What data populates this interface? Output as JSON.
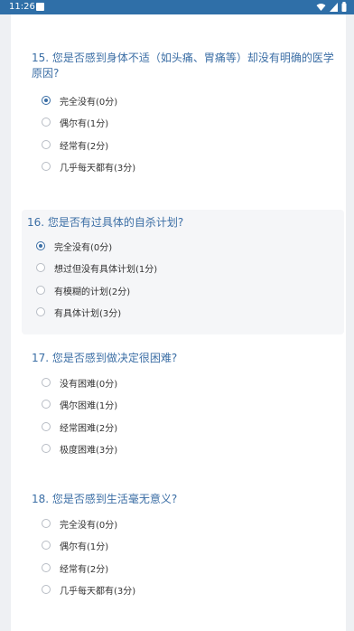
{
  "statusbar": {
    "time": "11:26"
  },
  "questions": [
    {
      "title": "15. 您是否感到身体不适（如头痛、胃痛等）却没有明确的医学原因?",
      "options": [
        "完全没有(0分)",
        "偶尔有(1分)",
        "经常有(2分)",
        "几乎每天都有(3分)"
      ],
      "selected": 0
    },
    {
      "title": "16. 您是否有过具体的自杀计划?",
      "options": [
        "完全没有(0分)",
        "想过但没有具体计划(1分)",
        "有模糊的计划(2分)",
        "有具体计划(3分)"
      ],
      "selected": 0
    },
    {
      "title": "17. 您是否感到做决定很困难?",
      "options": [
        "没有困难(0分)",
        "偶尔困难(1分)",
        "经常困难(2分)",
        "极度困难(3分)"
      ],
      "selected": null
    },
    {
      "title": "18. 您是否感到生活毫无意义?",
      "options": [
        "完全没有(0分)",
        "偶尔有(1分)",
        "经常有(2分)",
        "几乎每天都有(3分)"
      ],
      "selected": null
    }
  ],
  "colors": {
    "accent": "#3b6ea5",
    "statusbar": "#2f6fa8",
    "background": "#eef0f3"
  },
  "icons": [
    "notification-icon",
    "wifi-icon",
    "signal-icon",
    "battery-icon",
    "radio-icon"
  ]
}
